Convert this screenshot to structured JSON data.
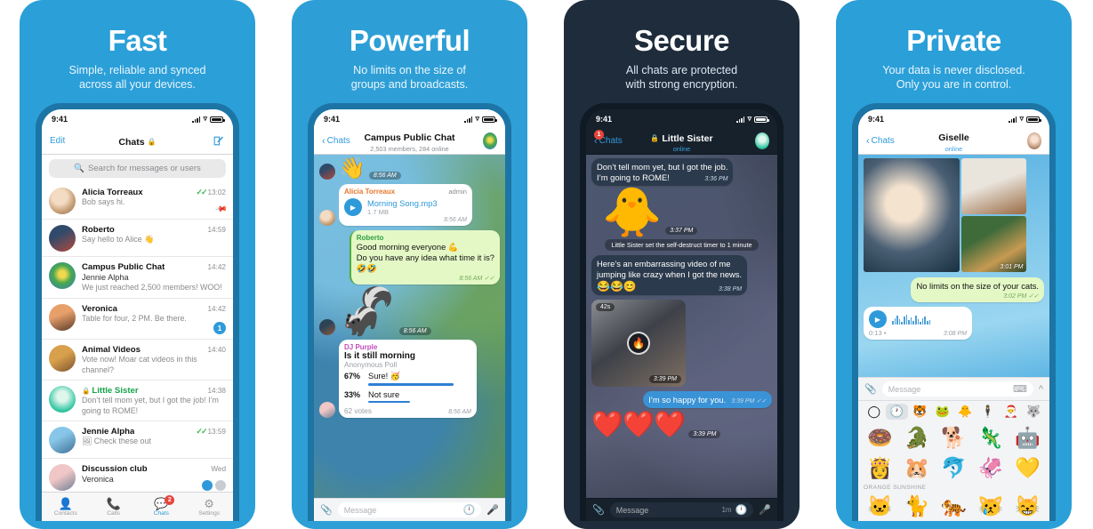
{
  "panels": [
    {
      "id": "fast",
      "headline": "Fast",
      "subhead_line1": "Simple, reliable and synced",
      "subhead_line2": "across all your devices.",
      "status": {
        "time": "9:41"
      },
      "nav": {
        "left": "Edit",
        "title": "Chats",
        "lock_icon": "lock-icon",
        "right_icon": "compose-icon"
      },
      "search": {
        "placeholder": "Search for messages or users",
        "icon": "search-icon"
      },
      "chats": [
        {
          "name": "Alicia Torreaux",
          "msg": "Bob says hi.",
          "time": "13:02",
          "tick": "✓✓",
          "pinned": true
        },
        {
          "name": "Roberto",
          "msg": "Say hello to Alice 👋",
          "time": "14:59"
        },
        {
          "name": "Campus Public Chat",
          "sender": "Jennie Alpha",
          "msg": "We just reached 2,500 members! WOO!",
          "time": "14:42"
        },
        {
          "name": "Veronica",
          "msg": "Table for four, 2 PM. Be there.",
          "time": "14:42",
          "unread": "1"
        },
        {
          "name": "Animal Videos",
          "msg": "Vote now! Moar cat videos in this channel?",
          "time": "14:40"
        },
        {
          "name": "Little Sister",
          "msg": "Don’t tell mom yet, but I got the job! I’m going to ROME!",
          "time": "14:38",
          "secret": true
        },
        {
          "name": "Jennie Alpha",
          "msg": "🖼 Check these out",
          "time": "13:59",
          "tick": "✓✓"
        },
        {
          "name": "Discussion club",
          "sender": "Veronica",
          "msg": "",
          "time": "Wed"
        }
      ],
      "tabs": [
        {
          "label": "Contacts",
          "icon": "contacts-icon",
          "active": false
        },
        {
          "label": "Calls",
          "icon": "phone-icon",
          "active": false
        },
        {
          "label": "Chats",
          "icon": "chats-icon",
          "active": true,
          "badge": "2"
        },
        {
          "label": "Settings",
          "icon": "gear-icon",
          "active": false
        }
      ]
    },
    {
      "id": "powerful",
      "headline": "Powerful",
      "subhead_line1": "No limits on the size of",
      "subhead_line2": "groups and broadcasts.",
      "status": {
        "time": "9:41"
      },
      "nav": {
        "left": "Chats",
        "title": "Campus Public Chat",
        "subtitle": "2,503 members, 284 online"
      },
      "messages": {
        "wave_emoji": "👋",
        "wave_time": "8:56 AM",
        "audio": {
          "sender": "Alicia Torreaux",
          "role": "admin",
          "title": "Morning Song.mp3",
          "size": "1.7 MB",
          "time": "8:56 AM"
        },
        "green": {
          "sender": "Roberto",
          "line1": "Good morning everyone 💪",
          "line2": "Do you have any idea what time it is?",
          "line3": "🤣🤣",
          "time": "8:56 AM",
          "tick": "✓✓"
        },
        "sticker": {
          "emoji": "🦨",
          "time": "8:56 AM"
        },
        "poll": {
          "sender": "DJ Purple",
          "question": "Is it still morning",
          "type": "Anonymous Poll",
          "options": [
            {
              "pct": "67%",
              "label": "Sure! 🥳",
              "value": 67
            },
            {
              "pct": "33%",
              "label": "Not sure",
              "value": 33
            }
          ],
          "votes": "62 votes",
          "time": "8:56 AM"
        }
      },
      "input": {
        "placeholder": "Message",
        "attach_icon": "paperclip-icon",
        "timer_icon": "clock-icon",
        "mic_icon": "mic-icon"
      }
    },
    {
      "id": "secure",
      "headline": "Secure",
      "subhead_line1": "All chats are protected",
      "subhead_line2": "with strong encryption.",
      "status": {
        "time": "9:41"
      },
      "nav": {
        "left": "Chats",
        "badge": "1",
        "title": "Little Sister",
        "lock_icon": "lock-icon",
        "subtitle": "online"
      },
      "messages": {
        "first": {
          "line1": "Don’t tell mom yet, but I got the job.",
          "line2": "I’m going to ROME!",
          "time": "3:36 PM"
        },
        "sticker": {
          "emoji": "🐥",
          "time": "3:37 PM"
        },
        "service": "Little Sister set the self-destruct timer to 1 minute",
        "second": {
          "line1": "Here’s an embarrassing video of me",
          "line2": "jumping like crazy when I got the news.",
          "line3": "😂😂😊",
          "time": "3:38 PM"
        },
        "video": {
          "duration": "42s",
          "time": "3:39 PM",
          "icon": "flame-icon"
        },
        "reply": {
          "text": "I’m so happy for you.",
          "time": "3:39 PM",
          "tick": "✓✓"
        },
        "hearts": {
          "emoji": "❤️❤️❤️",
          "time": "3:39 PM"
        }
      },
      "input": {
        "placeholder": "Message",
        "timer_value": "1m",
        "attach_icon": "paperclip-icon",
        "timer_icon": "clock-icon",
        "mic_icon": "mic-icon"
      }
    },
    {
      "id": "private",
      "headline": "Private",
      "subhead_line1": "Your data is never disclosed.",
      "subhead_line2": "Only you are in control.",
      "status": {
        "time": "9:41"
      },
      "nav": {
        "left": "Chats",
        "title": "Giselle",
        "subtitle": "online"
      },
      "messages": {
        "media_time": "3:01 PM",
        "green": {
          "text": "No limits on the size of your cats.",
          "time": "3:02 PM",
          "tick": "✓✓"
        },
        "voice": {
          "duration": "0:13",
          "dot": "•",
          "time": "3:08 PM",
          "play_icon": "play-icon"
        }
      },
      "input": {
        "placeholder": "Message",
        "attach_icon": "paperclip-icon",
        "keyboard_icon": "keyboard-icon",
        "collapse_icon": "chevron-up-icon"
      },
      "sticker_panel": {
        "tabs": [
          "recent-icon",
          "clock-icon",
          "🐯",
          "🐸",
          "🐥",
          "🕴",
          "🎅",
          "🐺"
        ],
        "selected_tab_index": 1,
        "row1": [
          "🍩",
          "🐊",
          "🐕",
          "🦎",
          "🤖"
        ],
        "row2": [
          "👸",
          "🐹",
          "🐬",
          "🦑",
          "💛"
        ],
        "section_label": "ORANGE SUNSHINE",
        "row3": [
          "🐱",
          "🐈",
          "🐅",
          "😿",
          "😸"
        ]
      }
    }
  ],
  "colors": {
    "brand_blue": "#2b9fd8",
    "dark_navy": "#1e2c3c",
    "accent_blue": "#2f9ad9",
    "green_tick": "#3fb950",
    "red_badge": "#e8453c"
  }
}
